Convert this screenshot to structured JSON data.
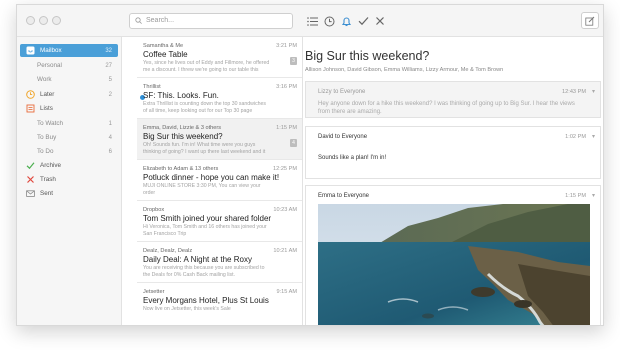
{
  "search": {
    "placeholder": "Search..."
  },
  "toolbar": {
    "icons": [
      "list-icon",
      "clock-icon",
      "bell-icon",
      "check-icon",
      "close-icon"
    ],
    "compose_icon": "compose-icon"
  },
  "sidebar": {
    "mailbox": {
      "label": "Mailbox",
      "count": "32"
    },
    "personal": {
      "label": "Personal",
      "count": "27"
    },
    "work": {
      "label": "Work",
      "count": "5"
    },
    "later": {
      "label": "Later",
      "count": "2"
    },
    "lists": {
      "label": "Lists"
    },
    "to_watch": {
      "label": "To Watch",
      "count": "1"
    },
    "to_buy": {
      "label": "To Buy",
      "count": "4"
    },
    "to_do": {
      "label": "To Do",
      "count": "6"
    },
    "archive": {
      "label": "Archive"
    },
    "trash": {
      "label": "Trash"
    },
    "sent": {
      "label": "Sent"
    }
  },
  "messages": [
    {
      "sender": "Samantha & Me",
      "time": "3:21 PM",
      "subject": "Coffee Table",
      "preview": "Yes, since he lives out of Eddy and Fillmore, he offered me a discount. I threw we're going to our table this",
      "count": "3"
    },
    {
      "sender": "Thrillist",
      "time": "3:16 PM",
      "subject": "SF: This. Looks. Fun.",
      "preview": "Extra Thrillist is counting down the top 30 sandwiches of all time, keep looking out for our Top 30 page"
    },
    {
      "sender": "Emma, David, Lizzie & 3 others",
      "time": "1:15 PM",
      "subject": "Big Sur this weekend?",
      "preview": "Oh! Sounds fun. I'm in! What time were you guys thinking of going? I want up there last weekend and it",
      "count": "4"
    },
    {
      "sender": "Elizabeth to Adam & 13 others",
      "time": "12:25 PM",
      "subject": "Potluck dinner - hope you can make it!",
      "preview": "MUJI ONLINE STORE 3:30 PM, You can view your order"
    },
    {
      "sender": "Dropbox",
      "time": "10:23 AM",
      "subject": "Tom Smith joined your shared folder",
      "preview": "Hi Veronica, Tom Smith and 16 others has joined your San Francisco Trip"
    },
    {
      "sender": "Dealz, Dealz, Dealz",
      "time": "10:21 AM",
      "subject": "Daily Deal: A Night at the Roxy",
      "preview": "You are receiving this because you are subscribed to the Deals for 0% Cash Back mailing list."
    },
    {
      "sender": "Jetsetter",
      "time": "9:15 AM",
      "subject": "Every Morgans Hotel, Plus St Louis",
      "preview": "Now live on Jetsetter, this week's Sale"
    }
  ],
  "reader": {
    "title": "Big Sur this weekend?",
    "participants": "Allison Johnson, David Gibson, Emma Williams, Lizzy Armour, Me & Tom Brown",
    "threads": [
      {
        "from": "Lizzy to Everyone",
        "time": "12:43 PM",
        "body": "Hey anyone down for a hike this weekend? I was thinking of going up to Big Sur. I hear the views from there are amazing."
      },
      {
        "from": "David to Everyone",
        "time": "1:02 PM",
        "body": "Sounds like a plan! I'm in!"
      },
      {
        "from": "Emma to Everyone",
        "time": "1:15 PM"
      }
    ]
  },
  "colors": {
    "accent": "#4a9fd8",
    "unread": "#2f8fd6",
    "archive": "#4caf50",
    "trash": "#e0483e",
    "later": "#f0a52a"
  }
}
